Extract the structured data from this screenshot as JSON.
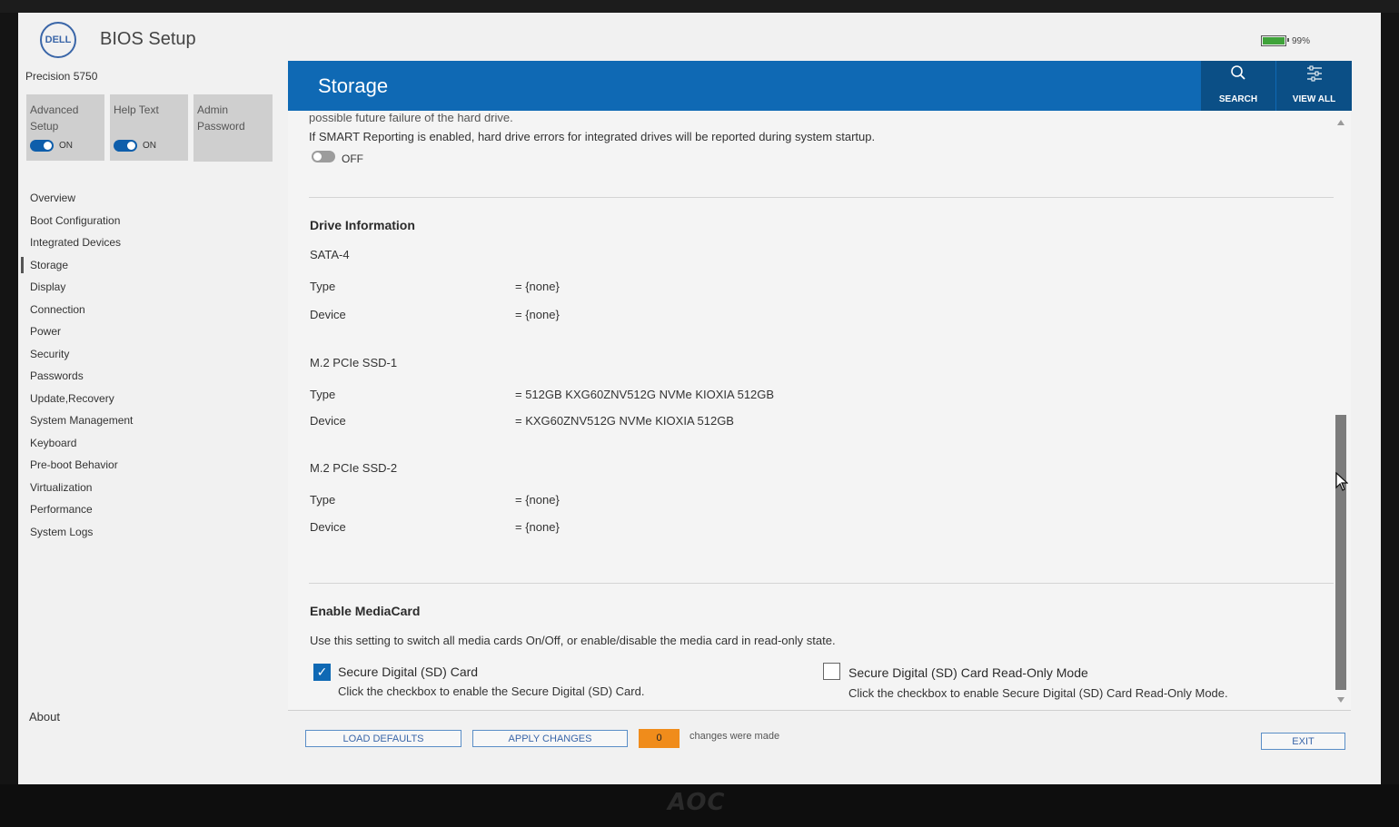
{
  "app": {
    "title": "BIOS Setup",
    "logo": "DELL",
    "battery": "99%"
  },
  "sidebar": {
    "model": "Precision 5750",
    "tiles": [
      {
        "label": "Advanced Setup",
        "state": "ON"
      },
      {
        "label": "Help Text",
        "state": "ON"
      },
      {
        "label": "Admin Password"
      }
    ],
    "items": [
      "Overview",
      "Boot Configuration",
      "Integrated Devices",
      "Storage",
      "Display",
      "Connection",
      "Power",
      "Security",
      "Passwords",
      "Update,Recovery",
      "System Management",
      "Keyboard",
      "Pre-boot Behavior",
      "Virtualization",
      "Performance",
      "System Logs"
    ],
    "active": "Storage",
    "about": "About"
  },
  "header": {
    "title": "Storage",
    "search": "SEARCH",
    "viewall": "VIEW ALL"
  },
  "smart": {
    "cut_text": "possible future failure of the hard drive.",
    "description": "If SMART Reporting is enabled, hard drive errors for integrated drives will be reported during system startup.",
    "toggle": "OFF"
  },
  "drive_info": {
    "heading": "Drive Information",
    "type_label": "Type",
    "device_label": "Device",
    "drives": [
      {
        "name": "SATA-4",
        "type": "= {none}",
        "device": "= {none}"
      },
      {
        "name": "M.2 PCIe SSD-1",
        "type": "= 512GB KXG60ZNV512G NVMe KIOXIA 512GB",
        "device": "= KXG60ZNV512G NVMe KIOXIA 512GB"
      },
      {
        "name": "M.2 PCIe SSD-2",
        "type": "= {none}",
        "device": "= {none}"
      }
    ]
  },
  "mediacard": {
    "heading": "Enable MediaCard",
    "description": "Use this setting to switch all media cards On/Off, or enable/disable the media card in read-only state.",
    "options": [
      {
        "title": "Secure Digital (SD) Card",
        "desc": "Click the checkbox to enable the Secure Digital (SD) Card.",
        "checked": true
      },
      {
        "title": "Secure Digital (SD) Card Read-Only Mode",
        "desc": "Click the checkbox to enable Secure Digital (SD) Card Read-Only Mode.",
        "checked": false
      }
    ]
  },
  "footer": {
    "load_defaults": "LOAD DEFAULTS",
    "apply_changes": "APPLY CHANGES",
    "count": "0",
    "changes_text": "changes were made",
    "exit": "EXIT"
  },
  "monitor_brand": "AOC",
  "colors": {
    "accent": "#0f69b4",
    "accent_dark": "#0b4f86",
    "badge": "#f08c1b"
  }
}
